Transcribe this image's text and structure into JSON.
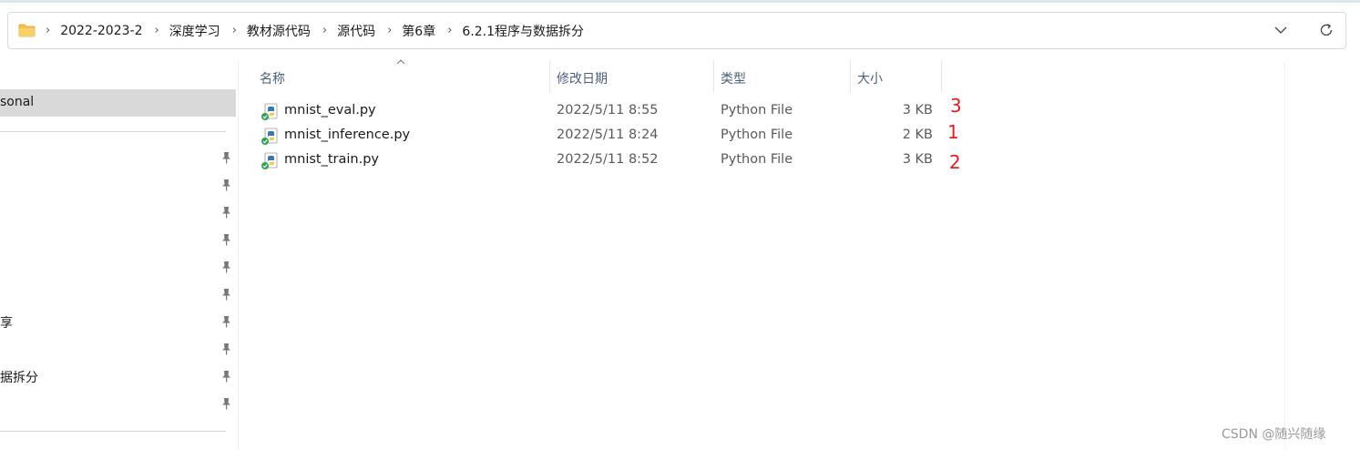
{
  "breadcrumb": {
    "items": [
      "2022-2023-2",
      "深度学习",
      "教材源代码",
      "源代码",
      "第6章",
      "6.2.1程序与数据拆分"
    ],
    "separator": "›"
  },
  "sidebar": {
    "selected_label": "sonal",
    "label_share": "享",
    "label_split": "据拆分"
  },
  "columns": {
    "name": "名称",
    "modified": "修改日期",
    "type": "类型",
    "size": "大小"
  },
  "files": [
    {
      "name": "mnist_eval.py",
      "modified": "2022/5/11 8:55",
      "type": "Python File",
      "size": "3 KB"
    },
    {
      "name": "mnist_inference.py",
      "modified": "2022/5/11 8:24",
      "type": "Python File",
      "size": "2 KB"
    },
    {
      "name": "mnist_train.py",
      "modified": "2022/5/11 8:52",
      "type": "Python File",
      "size": "3 KB"
    }
  ],
  "annotations": [
    "3",
    "1",
    "2"
  ],
  "watermark": "CSDN @随兴随缘",
  "colors": {
    "annotation": "#e02020",
    "selected_bg": "#d9d9d9",
    "header_text": "#4c607a",
    "folder": "#f2c14e"
  }
}
